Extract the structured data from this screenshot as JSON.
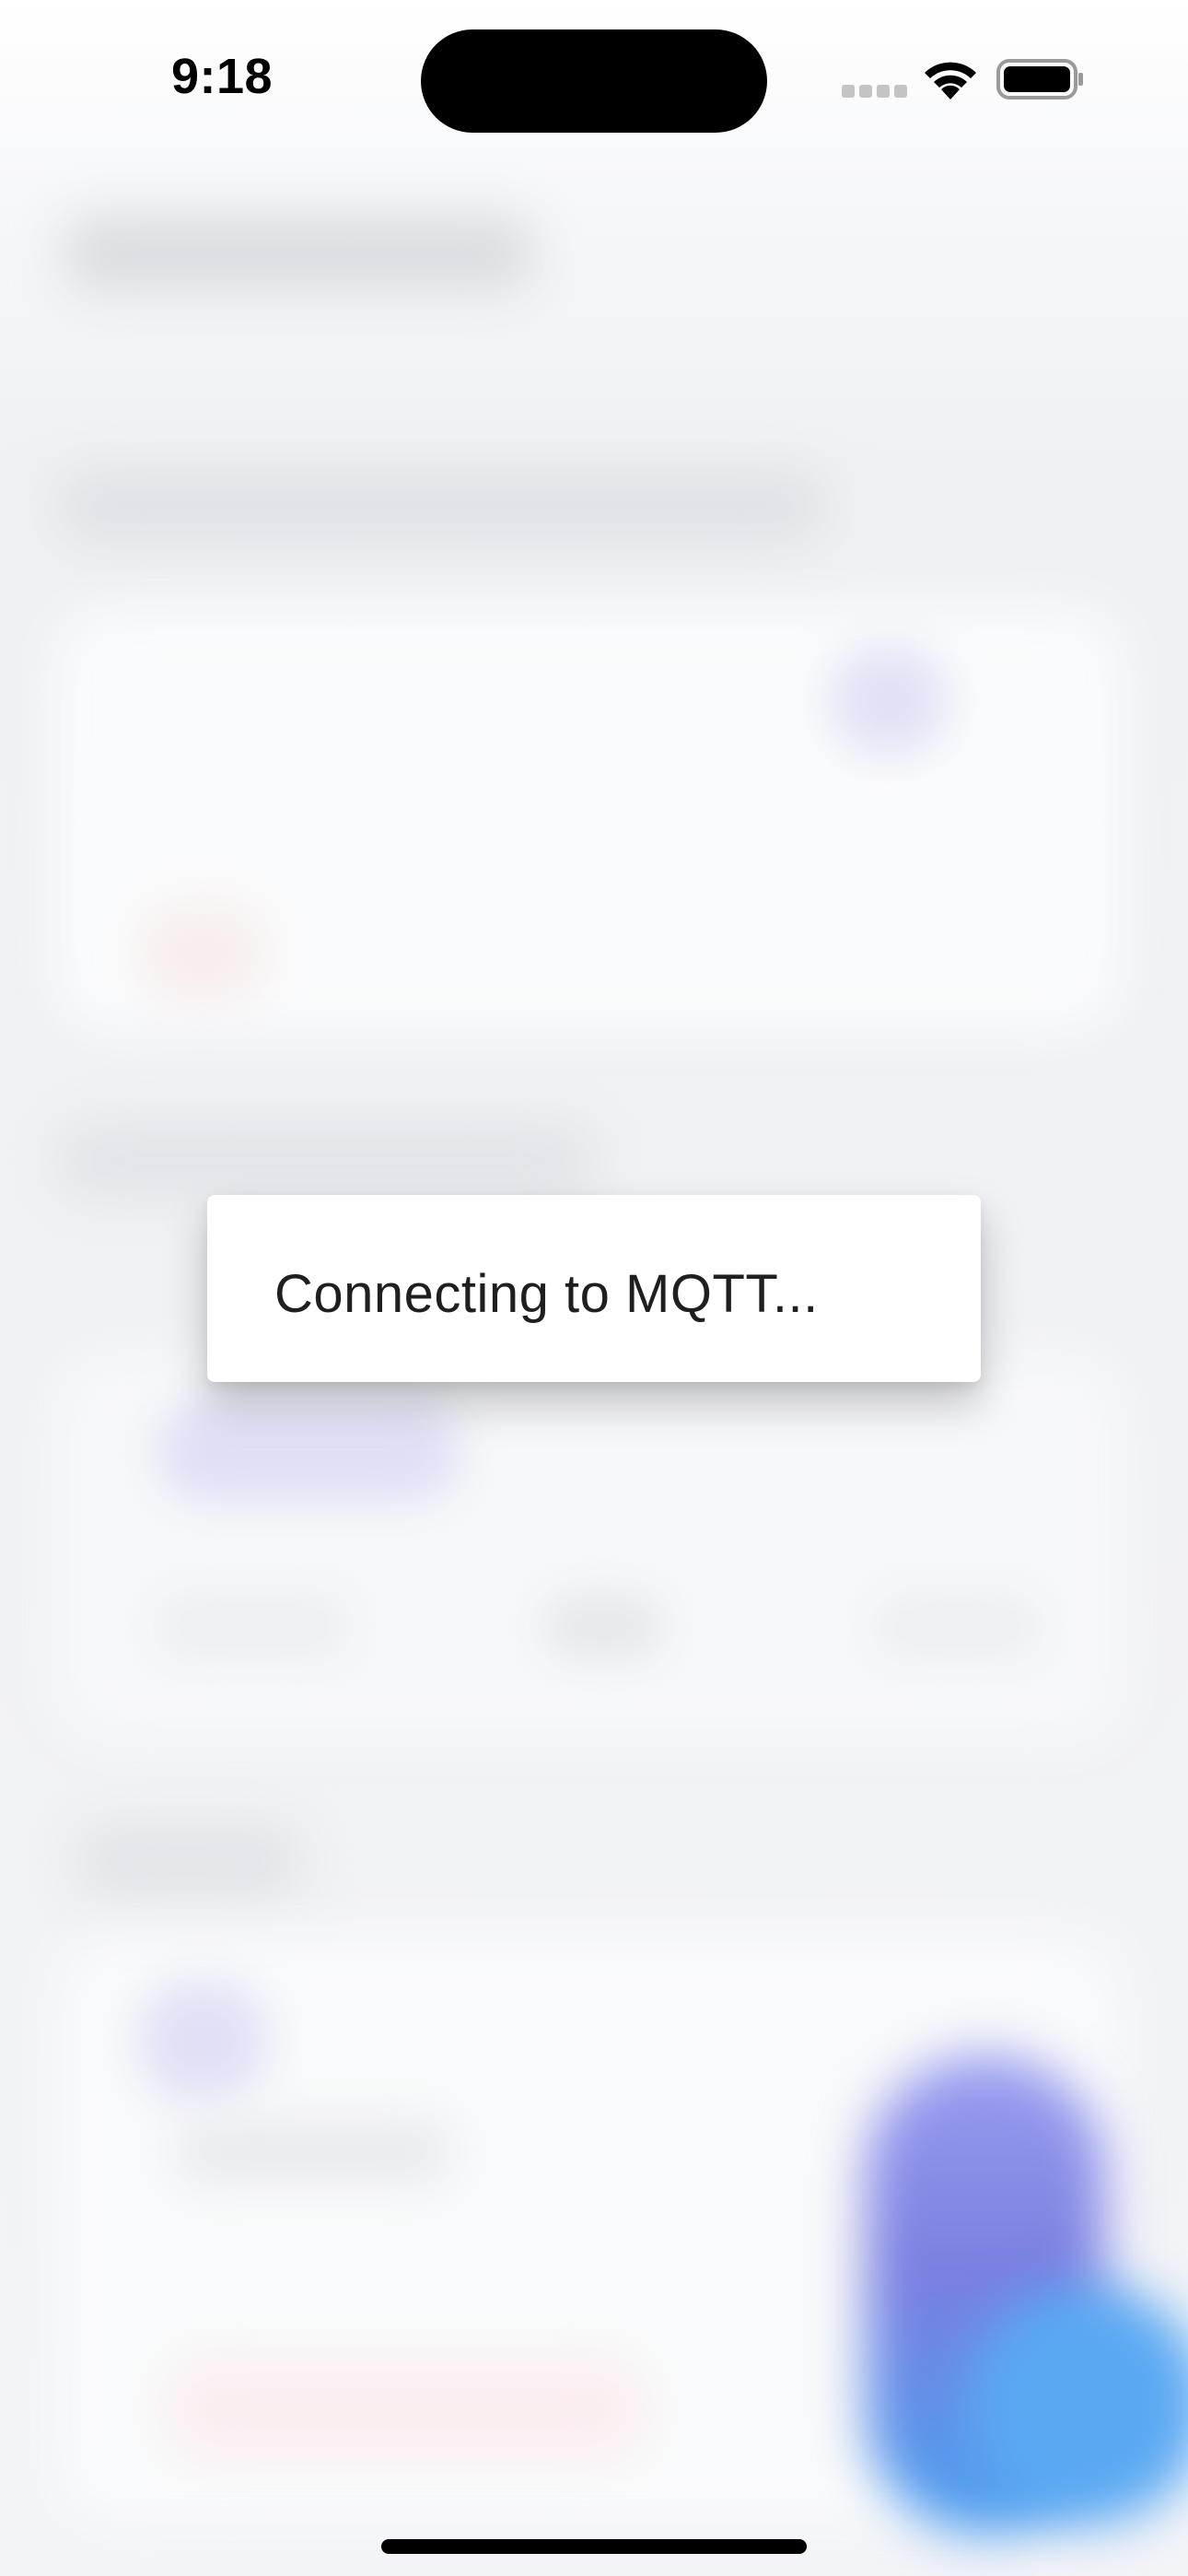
{
  "status_bar": {
    "time": "9:18",
    "icons": [
      "cellular-signal-icon",
      "wifi-icon",
      "battery-icon"
    ]
  },
  "dialog": {
    "message": "Connecting to MQTT..."
  },
  "colors": {
    "dialog_background": "#ffffff",
    "dialog_text": "#1f1f1f",
    "fab_gradient_start": "#7b7fe0",
    "fab_gradient_end": "#4aa0f0"
  }
}
